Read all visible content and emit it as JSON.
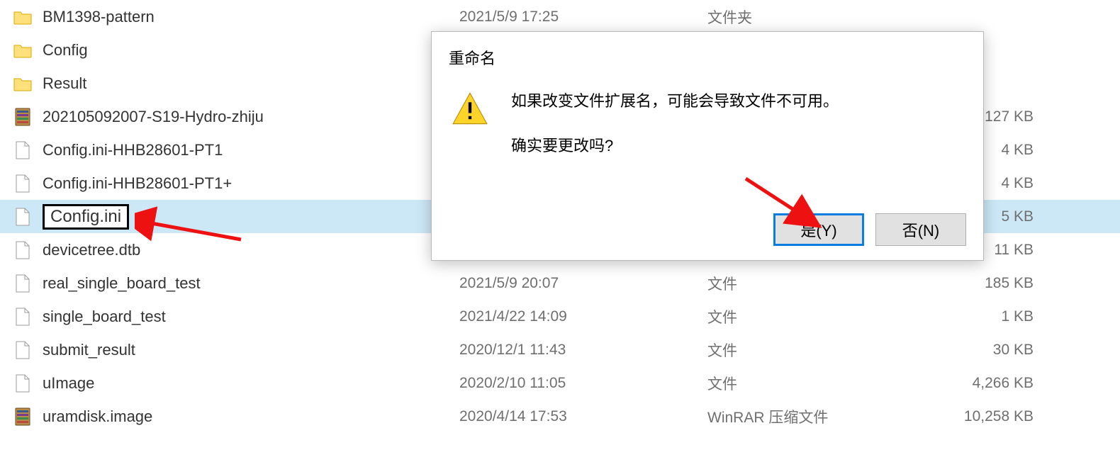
{
  "files": [
    {
      "name": "BM1398-pattern",
      "date": "2021/5/9 17:25",
      "type": "文件夹",
      "size": "",
      "icon": "folder"
    },
    {
      "name": "Config",
      "date": "",
      "type": "",
      "size": "",
      "icon": "folder"
    },
    {
      "name": "Result",
      "date": "",
      "type": "",
      "size": "",
      "icon": "folder"
    },
    {
      "name": "202105092007-S19-Hydro-zhiju",
      "date": "",
      "type": "",
      "size": "127 KB",
      "icon": "rar"
    },
    {
      "name": "Config.ini-HHB28601-PT1",
      "date": "",
      "type": "",
      "size": "4 KB",
      "icon": "doc"
    },
    {
      "name": "Config.ini-HHB28601-PT1+",
      "date": "",
      "type": "",
      "size": "4 KB",
      "icon": "doc"
    },
    {
      "name": "Config.ini",
      "date": "",
      "type": "",
      "size": "5 KB",
      "icon": "doc",
      "selected": true,
      "rename": true
    },
    {
      "name": "devicetree.dtb",
      "date": "",
      "type": "",
      "size": "11 KB",
      "icon": "doc"
    },
    {
      "name": "real_single_board_test",
      "date": "2021/5/9 20:07",
      "type": "文件",
      "size": "185 KB",
      "icon": "doc"
    },
    {
      "name": "single_board_test",
      "date": "2021/4/22 14:09",
      "type": "文件",
      "size": "1 KB",
      "icon": "doc"
    },
    {
      "name": "submit_result",
      "date": "2020/12/1 11:43",
      "type": "文件",
      "size": "30 KB",
      "icon": "doc"
    },
    {
      "name": "uImage",
      "date": "2020/2/10 11:05",
      "type": "文件",
      "size": "4,266 KB",
      "icon": "doc"
    },
    {
      "name": "uramdisk.image",
      "date": "2020/4/14 17:53",
      "type": "WinRAR 压缩文件",
      "size": "10,258 KB",
      "icon": "rar"
    }
  ],
  "dialog": {
    "title": "重命名",
    "line1": "如果改变文件扩展名，可能会导致文件不可用。",
    "line2": "确实要更改吗?",
    "yes": "是(Y)",
    "no": "否(N)"
  }
}
